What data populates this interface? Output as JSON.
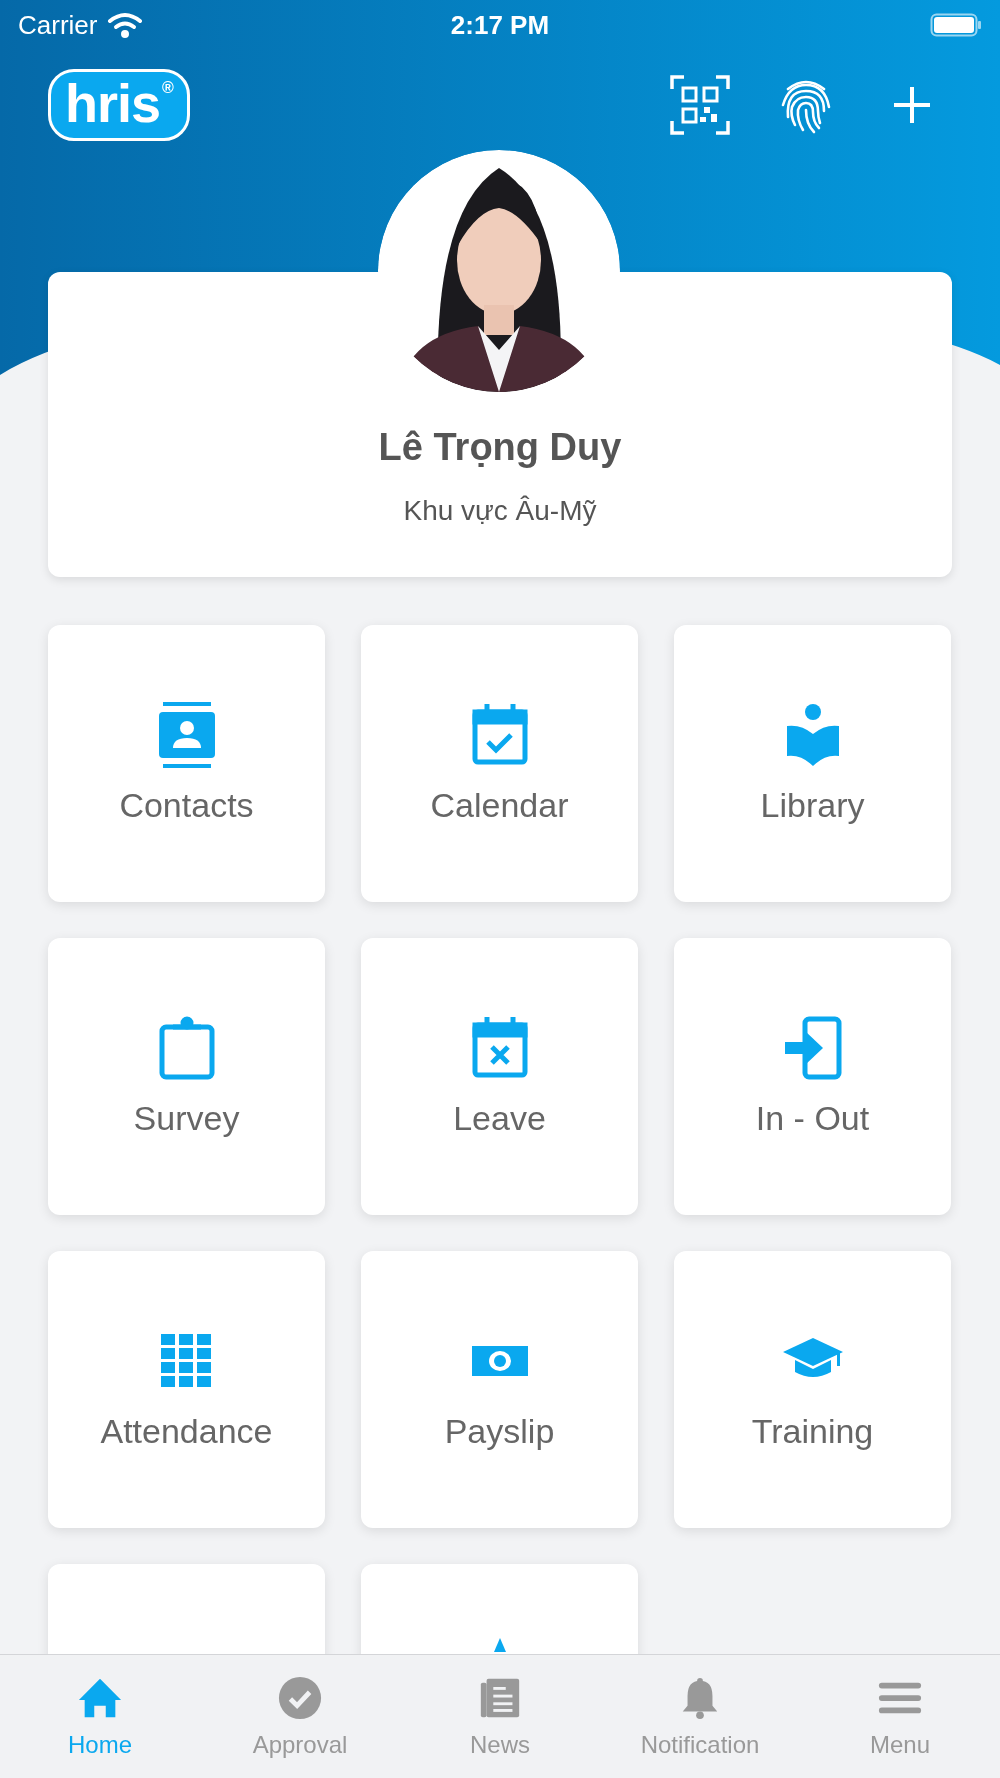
{
  "status_bar": {
    "carrier": "Carrier",
    "time": "2:17 PM"
  },
  "header": {
    "logo": "hris",
    "logo_mark": "®"
  },
  "profile": {
    "name": "Lê Trọng Duy",
    "region": "Khu vực Âu-Mỹ"
  },
  "tiles": [
    {
      "label": "Contacts",
      "kind": "contacts"
    },
    {
      "label": "Calendar",
      "kind": "calendar"
    },
    {
      "label": "Library",
      "kind": "library"
    },
    {
      "label": "Survey",
      "kind": "survey"
    },
    {
      "label": "Leave",
      "kind": "leave"
    },
    {
      "label": "In - Out",
      "kind": "inout"
    },
    {
      "label": "Attendance",
      "kind": "attendance"
    },
    {
      "label": "Payslip",
      "kind": "payslip"
    },
    {
      "label": "Training",
      "kind": "training"
    },
    {
      "kind": "blank"
    },
    {
      "kind": "tip"
    }
  ],
  "tab_bar": [
    {
      "label": "Home",
      "kind": "home",
      "selected": true
    },
    {
      "label": "Approval",
      "kind": "approval",
      "selected": false
    },
    {
      "label": "News",
      "kind": "news",
      "selected": false
    },
    {
      "label": "Notification",
      "kind": "bell",
      "selected": false
    },
    {
      "label": "Menu",
      "kind": "menu",
      "selected": false
    }
  ]
}
